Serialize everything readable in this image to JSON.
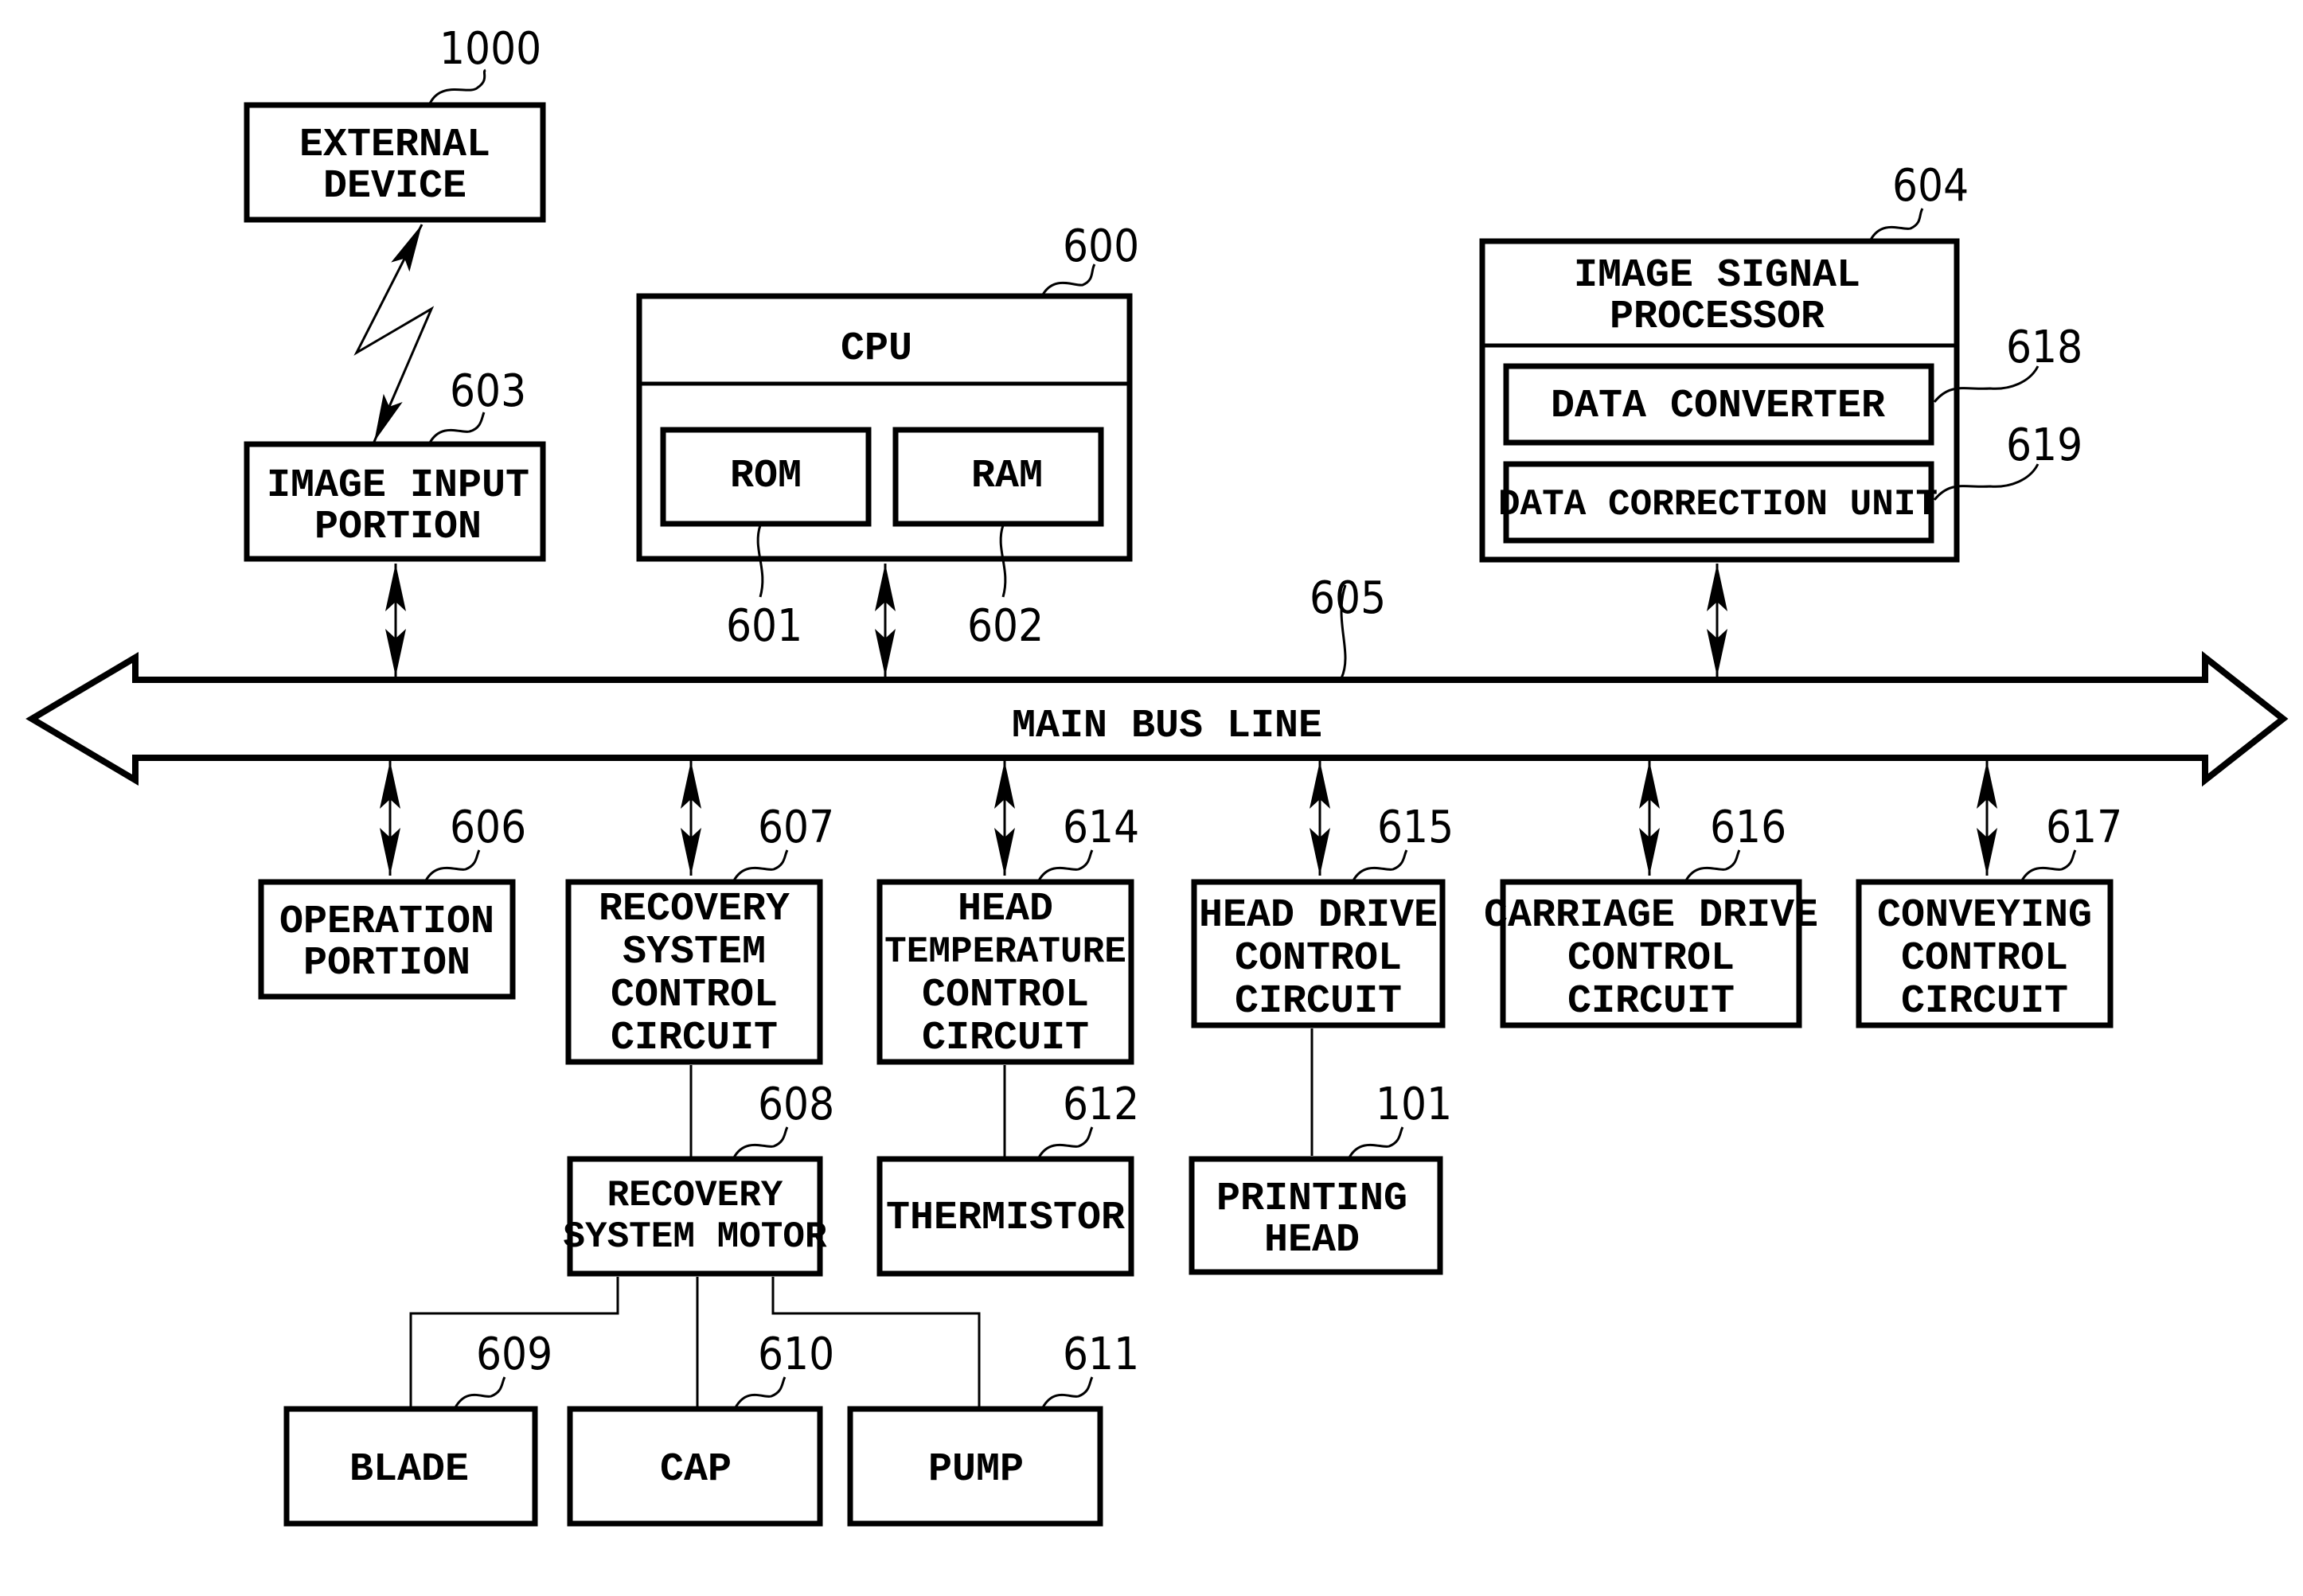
{
  "diagram": {
    "bus": {
      "label": "MAIN BUS LINE",
      "ref": "605"
    },
    "blocks": {
      "external_device": {
        "lines": [
          "EXTERNAL",
          "DEVICE"
        ],
        "ref": "1000"
      },
      "image_input": {
        "lines": [
          "IMAGE INPUT",
          "PORTION"
        ],
        "ref": "603"
      },
      "cpu": {
        "lines": [
          "CPU"
        ],
        "ref": "600"
      },
      "rom": {
        "lines": [
          "ROM"
        ],
        "ref": "601"
      },
      "ram": {
        "lines": [
          "RAM"
        ],
        "ref": "602"
      },
      "isp": {
        "lines": [
          "IMAGE SIGNAL",
          "PROCESSOR"
        ],
        "ref": "604"
      },
      "data_converter": {
        "lines": [
          "DATA CONVERTER"
        ],
        "ref": "618"
      },
      "data_correction": {
        "lines": [
          "DATA CORRECTION UNIT"
        ],
        "ref": "619"
      },
      "operation": {
        "lines": [
          "OPERATION",
          "PORTION"
        ],
        "ref": "606"
      },
      "recovery_ctrl": {
        "lines": [
          "RECOVERY",
          "SYSTEM",
          "CONTROL",
          "CIRCUIT"
        ],
        "ref": "607"
      },
      "head_temp": {
        "lines": [
          "HEAD",
          "TEMPERATURE",
          "CONTROL",
          "CIRCUIT"
        ],
        "ref": "614"
      },
      "head_drive": {
        "lines": [
          "HEAD DRIVE",
          "CONTROL",
          "CIRCUIT"
        ],
        "ref": "615"
      },
      "carriage": {
        "lines": [
          "CARRIAGE DRIVE",
          "CONTROL",
          "CIRCUIT"
        ],
        "ref": "616"
      },
      "conveying": {
        "lines": [
          "CONVEYING",
          "CONTROL",
          "CIRCUIT"
        ],
        "ref": "617"
      },
      "recovery_motor": {
        "lines": [
          "RECOVERY",
          "SYSTEM MOTOR"
        ],
        "ref": "608"
      },
      "thermistor": {
        "lines": [
          "THERMISTOR"
        ],
        "ref": "612"
      },
      "printing_head": {
        "lines": [
          "PRINTING",
          "HEAD"
        ],
        "ref": "101"
      },
      "blade": {
        "lines": [
          "BLADE"
        ],
        "ref": "609"
      },
      "cap": {
        "lines": [
          "CAP"
        ],
        "ref": "610"
      },
      "pump": {
        "lines": [
          "PUMP"
        ],
        "ref": "611"
      }
    }
  }
}
